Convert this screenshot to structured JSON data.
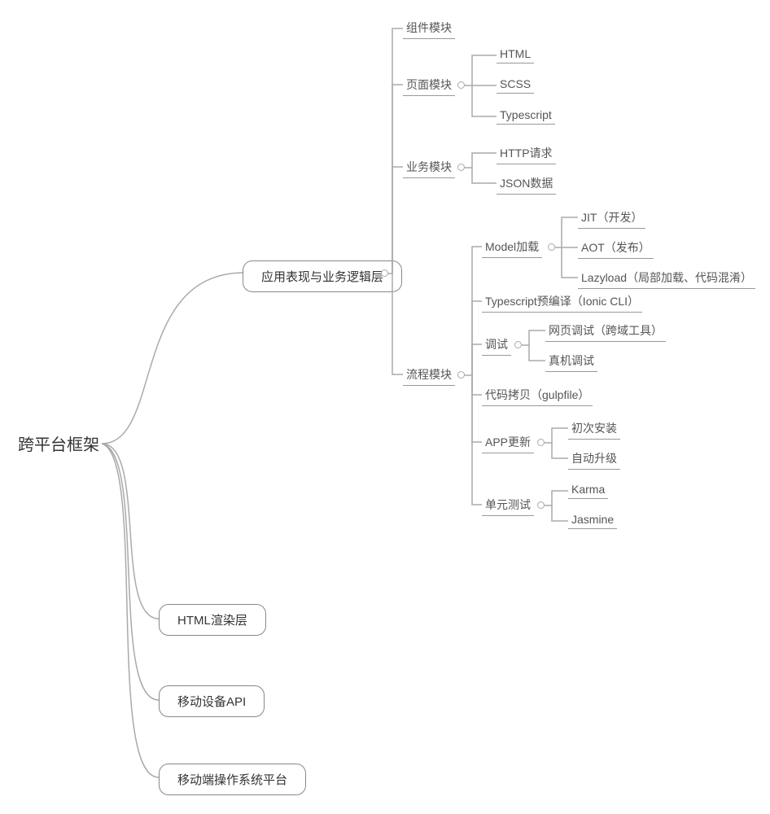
{
  "root": {
    "label": "跨平台框架"
  },
  "level1": {
    "logic": "应用表现与业务逻辑层",
    "html_render": "HTML渲染层",
    "mobile_api": "移动设备API",
    "mobile_os": "移动端操作系统平台"
  },
  "logic_children": {
    "component": "组件模块",
    "page": "页面模块",
    "business": "业务模块",
    "process": "流程模块"
  },
  "page_children": {
    "html": "HTML",
    "scss": "SCSS",
    "ts": "Typescript"
  },
  "business_children": {
    "http": "HTTP请求",
    "json": "JSON数据"
  },
  "process_children": {
    "model": "Model加载",
    "ts_pre": "Typescript预编译（Ionic CLI）",
    "debug": "调试",
    "copy": "代码拷贝（gulpfile）",
    "update": "APP更新",
    "unit": "单元测试"
  },
  "model_children": {
    "jit": "JIT（开发）",
    "aot": "AOT（发布）",
    "lazy": "Lazyload（局部加载、代码混淆）"
  },
  "debug_children": {
    "web": "网页调试（跨域工具）",
    "real": "真机调试"
  },
  "update_children": {
    "first": "初次安装",
    "auto": "自动升级"
  },
  "unit_children": {
    "karma": "Karma",
    "jasmine": "Jasmine"
  }
}
